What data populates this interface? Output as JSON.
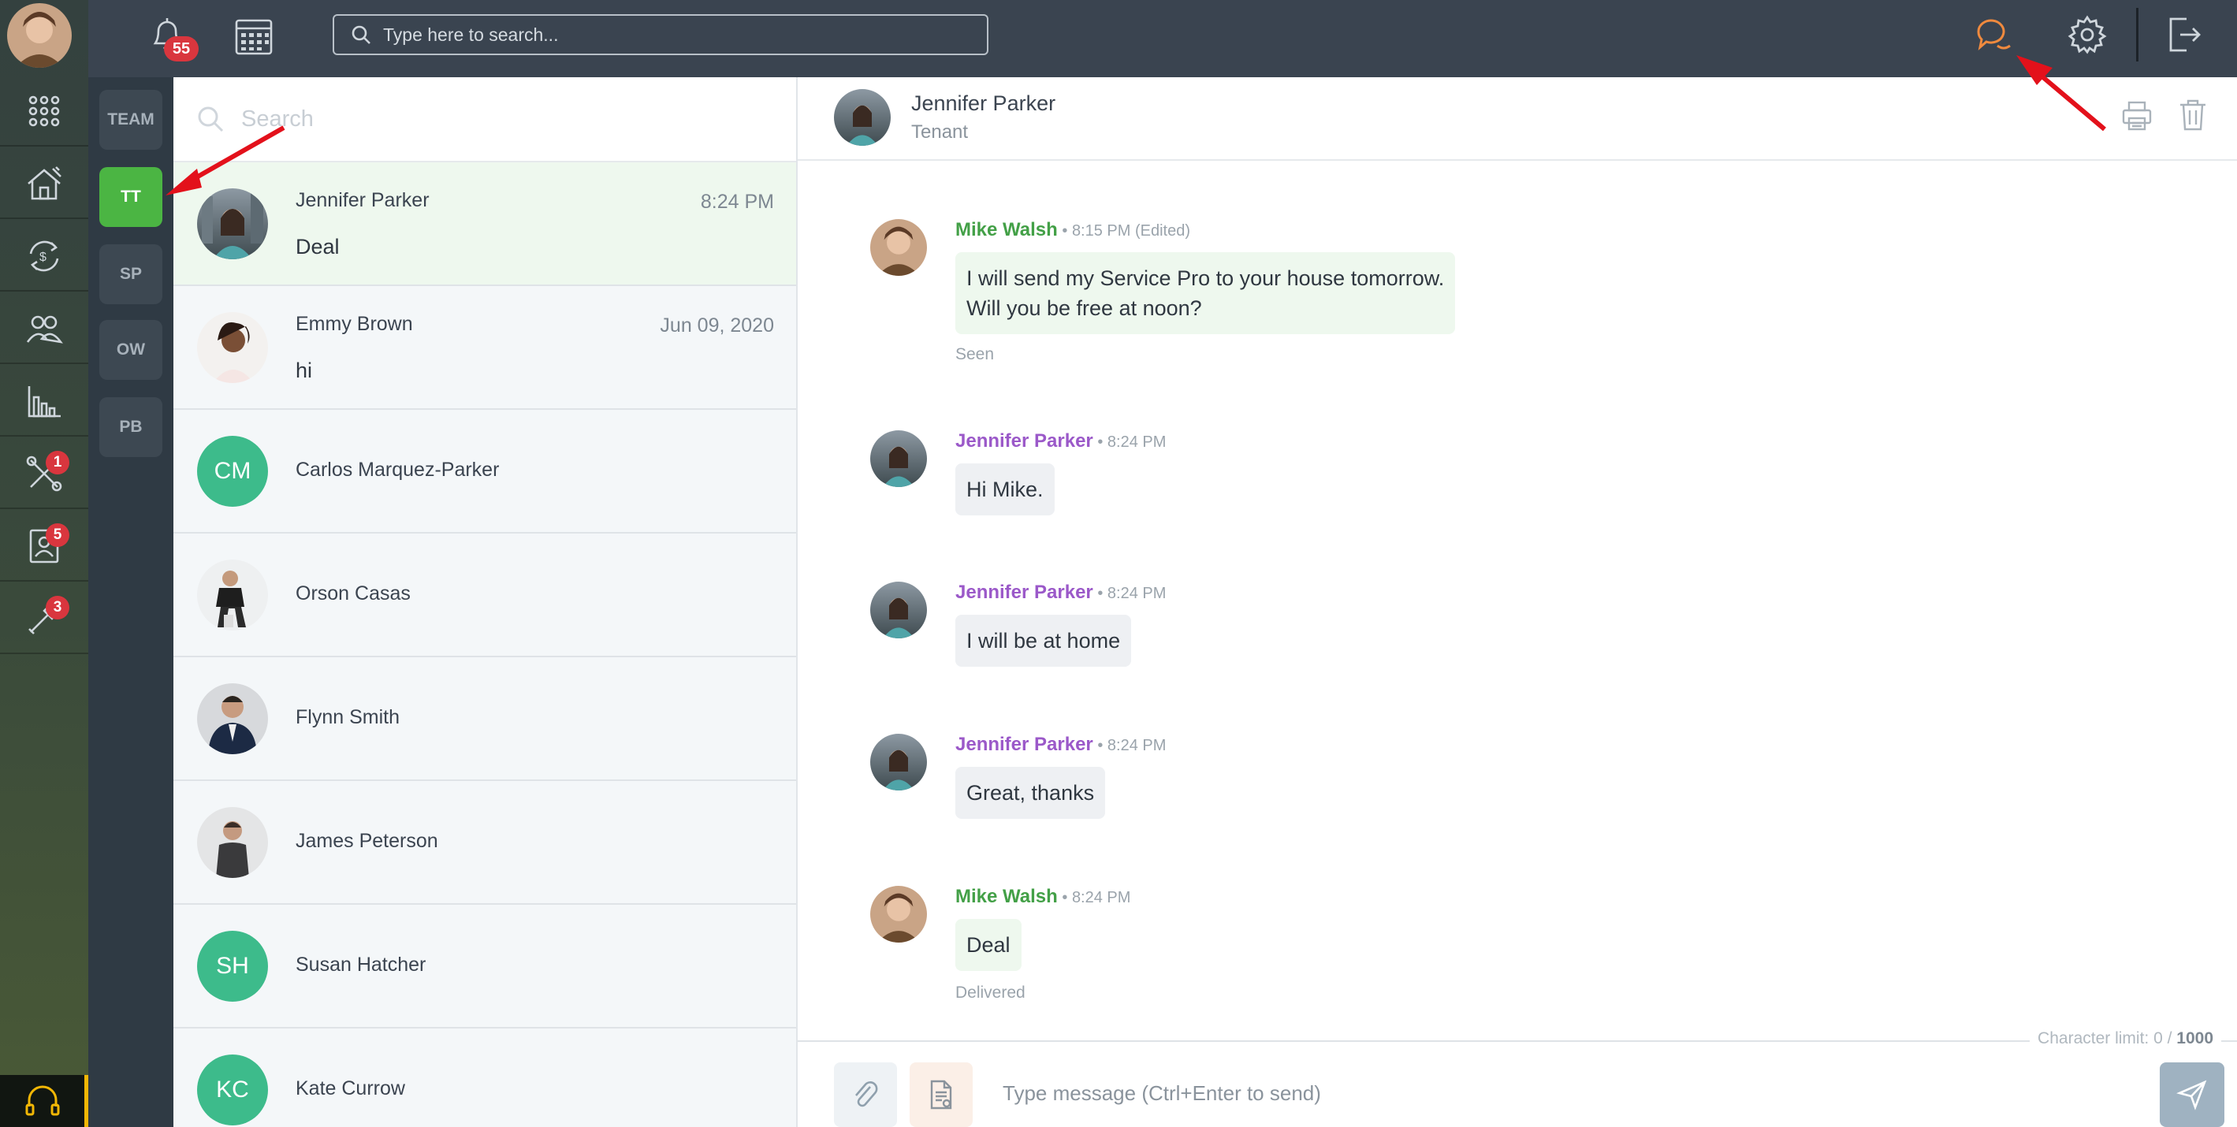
{
  "topbar": {
    "notifications_count": "55",
    "search_placeholder": "Type here to search..."
  },
  "rail": {
    "maintenance_badge": "1",
    "applications_badge": "5",
    "tools_badge": "3"
  },
  "categories": [
    "TEAM",
    "TT",
    "SP",
    "OW",
    "PB"
  ],
  "list": {
    "search_placeholder": "Search",
    "conversations": [
      {
        "name": "Jennifer Parker",
        "time": "8:24 PM",
        "message": "Deal"
      },
      {
        "name": "Emmy Brown",
        "time": "Jun 09, 2020",
        "message": "hi"
      },
      {
        "name": "Carlos Marquez-Parker",
        "initials": "CM"
      },
      {
        "name": "Orson Casas"
      },
      {
        "name": "Flynn Smith"
      },
      {
        "name": "James Peterson"
      },
      {
        "name": "Susan Hatcher",
        "initials": "SH"
      },
      {
        "name": "Kate Currow",
        "initials": "KC"
      }
    ]
  },
  "chat": {
    "contact_name": "Jennifer Parker",
    "contact_role": "Tenant",
    "messages": [
      {
        "author": "Mike Walsh",
        "time": "8:15 PM",
        "edited": "(Edited)",
        "lines": [
          "I will send my Service Pro to your house tomorrow.",
          "Will you be free at noon?"
        ],
        "status": "Seen"
      },
      {
        "author": "Jennifer Parker",
        "time": "8:24 PM",
        "text": "Hi Mike."
      },
      {
        "author": "Jennifer Parker",
        "time": "8:24 PM",
        "text": "I will be at home"
      },
      {
        "author": "Jennifer Parker",
        "time": "8:24 PM",
        "text": "Great, thanks"
      },
      {
        "author": "Mike Walsh",
        "time": "8:24 PM",
        "text": "Deal",
        "status": "Delivered"
      }
    ],
    "char_limit_label": "Character limit: 0 /",
    "char_limit_max": "1000",
    "composer_placeholder": "Type message (Ctrl+Enter to send)"
  },
  "colors": {
    "accent_green": "#4bb543",
    "topbar": "#3a4450",
    "chat_icon_active": "#f08a3e",
    "badge_red": "#d9363e",
    "mike_name": "#43a047",
    "jennifer_name": "#9b59c9"
  }
}
